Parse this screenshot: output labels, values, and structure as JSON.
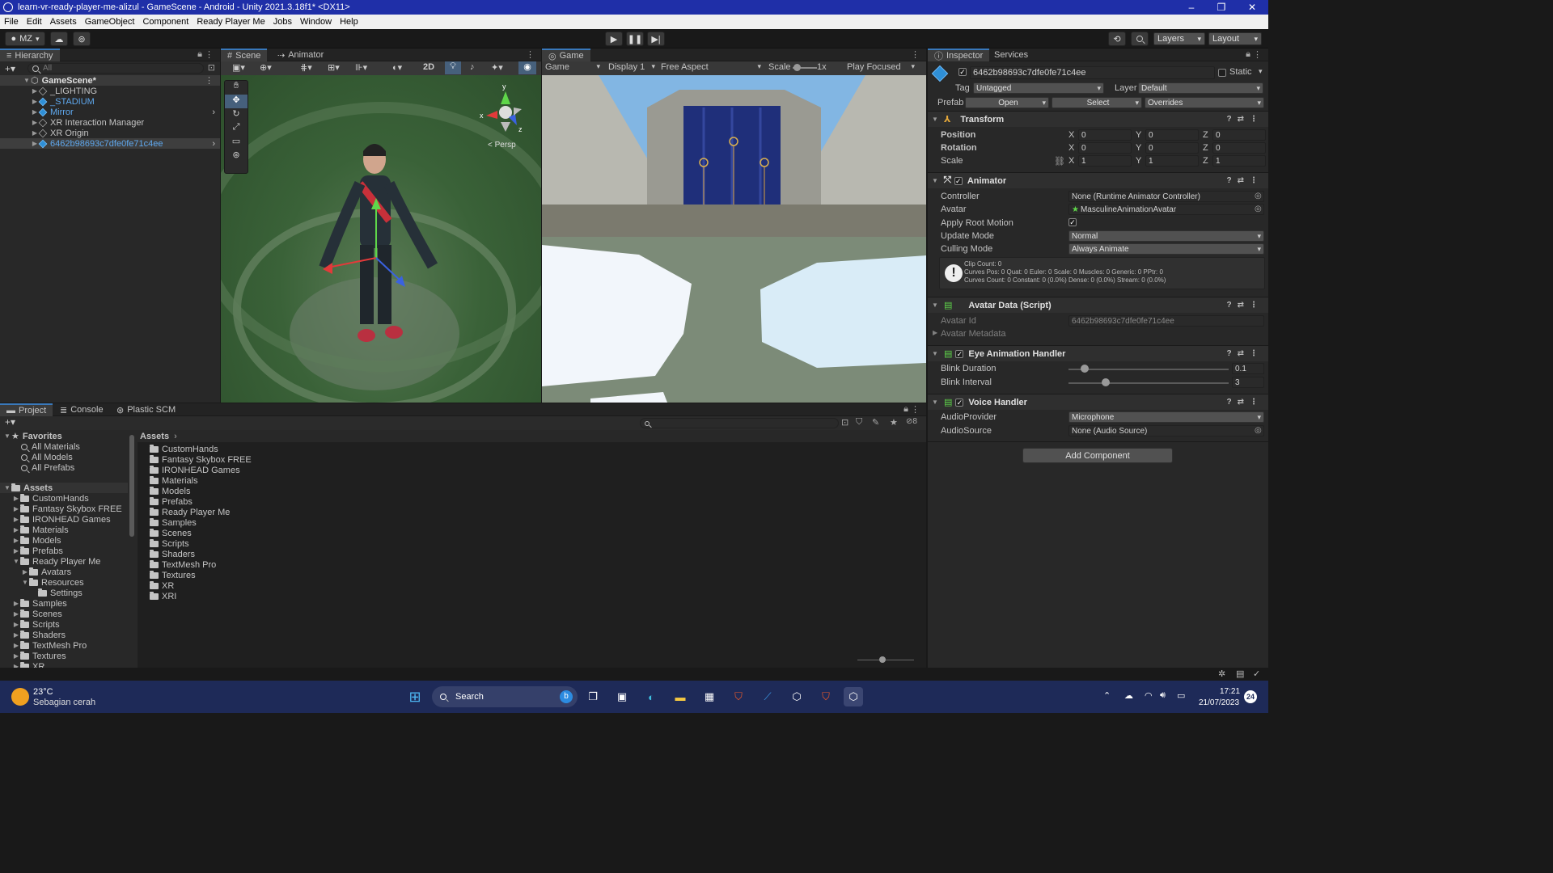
{
  "window": {
    "title": "learn-vr-ready-player-me-alizul - GameScene - Android - Unity 2021.3.18f1* <DX11>",
    "controls": [
      "–",
      "❐",
      "✕"
    ]
  },
  "menu": [
    "File",
    "Edit",
    "Assets",
    "GameObject",
    "Component",
    "Ready Player Me",
    "Jobs",
    "Window",
    "Help"
  ],
  "toolbar": {
    "account": "MZ",
    "layers": "Layers",
    "layout": "Layout"
  },
  "hierarchy": {
    "tab": "Hierarchy",
    "search_placeholder": "All",
    "scene": "GameScene*",
    "items": [
      {
        "label": "_LIGHTING",
        "blue": false
      },
      {
        "label": "_STADIUM",
        "blue": true
      },
      {
        "label": "Mirror",
        "blue": true
      },
      {
        "label": "XR Interaction Manager",
        "blue": false
      },
      {
        "label": "XR Origin",
        "blue": false
      },
      {
        "label": "6462b98693c7dfe0fe71c4ee",
        "blue": true
      }
    ]
  },
  "scene_view": {
    "tabs": [
      "Scene",
      "Animator"
    ],
    "mode_2d": "2D",
    "persp": "< Persp",
    "axis": {
      "y": "y",
      "x": "x",
      "z": "z"
    }
  },
  "game_view": {
    "tab": "Game",
    "mode": "Game",
    "display": "Display 1",
    "aspect": "Free Aspect",
    "scale_label": "Scale",
    "scale_value": "1x",
    "play_focused": "Play Focused"
  },
  "inspector": {
    "tabs": [
      "Inspector",
      "Services"
    ],
    "object_name": "6462b98693c7dfe0fe71c4ee",
    "static_label": "Static",
    "tag_label": "Tag",
    "tag_value": "Untagged",
    "layer_label": "Layer",
    "layer_value": "Default",
    "prefab_label": "Prefab",
    "prefab_open": "Open",
    "prefab_select": "Select",
    "prefab_overrides": "Overrides",
    "transform": {
      "title": "Transform",
      "position_label": "Position",
      "rotation_label": "Rotation",
      "scale_label": "Scale",
      "position": [
        "0",
        "0",
        "0"
      ],
      "rotation": [
        "0",
        "0",
        "0"
      ],
      "scale": [
        "1",
        "1",
        "1"
      ]
    },
    "animator": {
      "title": "Animator",
      "controller_label": "Controller",
      "controller_value": "None (Runtime Animator Controller)",
      "avatar_label": "Avatar",
      "avatar_value": "MasculineAnimationAvatar",
      "root_motion_label": "Apply Root Motion",
      "update_mode_label": "Update Mode",
      "update_mode_value": "Normal",
      "culling_mode_label": "Culling Mode",
      "culling_mode_value": "Always Animate",
      "info_line1": "Clip Count: 0",
      "info_line2": "Curves Pos: 0 Quat: 0 Euler: 0 Scale: 0 Muscles: 0 Generic: 0 PPtr: 0",
      "info_line3": "Curves Count: 0 Constant: 0 (0.0%) Dense: 0 (0.0%) Stream: 0 (0.0%)"
    },
    "avatar_data": {
      "title": "Avatar Data (Script)",
      "id_label": "Avatar Id",
      "id_value": "6462b98693c7dfe0fe71c4ee",
      "metadata_label": "Avatar Metadata"
    },
    "eye_handler": {
      "title": "Eye Animation Handler",
      "blink_duration_label": "Blink Duration",
      "blink_duration_value": "0.1",
      "blink_duration_fraction": 0.1,
      "blink_interval_label": "Blink Interval",
      "blink_interval_value": "3",
      "blink_interval_fraction": 0.23
    },
    "voice_handler": {
      "title": "Voice Handler",
      "provider_label": "AudioProvider",
      "provider_value": "Microphone",
      "source_label": "AudioSource",
      "source_value": "None (Audio Source)"
    },
    "add_component": "Add Component"
  },
  "project": {
    "tabs": [
      "Project",
      "Console",
      "Plastic SCM"
    ],
    "favorites_label": "Favorites",
    "favorites": [
      "All Materials",
      "All Models",
      "All Prefabs"
    ],
    "assets_label": "Assets",
    "tree": [
      {
        "label": "CustomHands",
        "depth": 1,
        "expanded": false
      },
      {
        "label": "Fantasy Skybox FREE",
        "depth": 1,
        "expanded": false
      },
      {
        "label": "IRONHEAD Games",
        "depth": 1,
        "expanded": false
      },
      {
        "label": "Materials",
        "depth": 1,
        "expanded": false
      },
      {
        "label": "Models",
        "depth": 1,
        "expanded": false
      },
      {
        "label": "Prefabs",
        "depth": 1,
        "expanded": false
      },
      {
        "label": "Ready Player Me",
        "depth": 1,
        "expanded": true
      },
      {
        "label": "Avatars",
        "depth": 2,
        "expanded": false
      },
      {
        "label": "Resources",
        "depth": 2,
        "expanded": true
      },
      {
        "label": "Settings",
        "depth": 3,
        "expanded": false
      },
      {
        "label": "Samples",
        "depth": 1,
        "expanded": false
      },
      {
        "label": "Scenes",
        "depth": 1,
        "expanded": false
      },
      {
        "label": "Scripts",
        "depth": 1,
        "expanded": false
      },
      {
        "label": "Shaders",
        "depth": 1,
        "expanded": false
      },
      {
        "label": "TextMesh Pro",
        "depth": 1,
        "expanded": false
      },
      {
        "label": "Textures",
        "depth": 1,
        "expanded": false
      },
      {
        "label": "XR",
        "depth": 1,
        "expanded": false
      }
    ],
    "breadcrumb": "Assets",
    "folders": [
      "CustomHands",
      "Fantasy Skybox FREE",
      "IRONHEAD Games",
      "Materials",
      "Models",
      "Prefabs",
      "Ready Player Me",
      "Samples",
      "Scenes",
      "Scripts",
      "Shaders",
      "TextMesh Pro",
      "Textures",
      "XR",
      "XRI"
    ],
    "hidden_count": "8"
  },
  "taskbar": {
    "weather_temp": "23°C",
    "weather_desc": "Sebagian cerah",
    "search_label": "Search",
    "time": "17:21",
    "date": "21/07/2023",
    "notifications": "24"
  },
  "colors": {
    "accent": "#3a79bb",
    "title_bar": "#1f2fa8",
    "taskbar": "#1e2a58",
    "panel": "#282828"
  }
}
